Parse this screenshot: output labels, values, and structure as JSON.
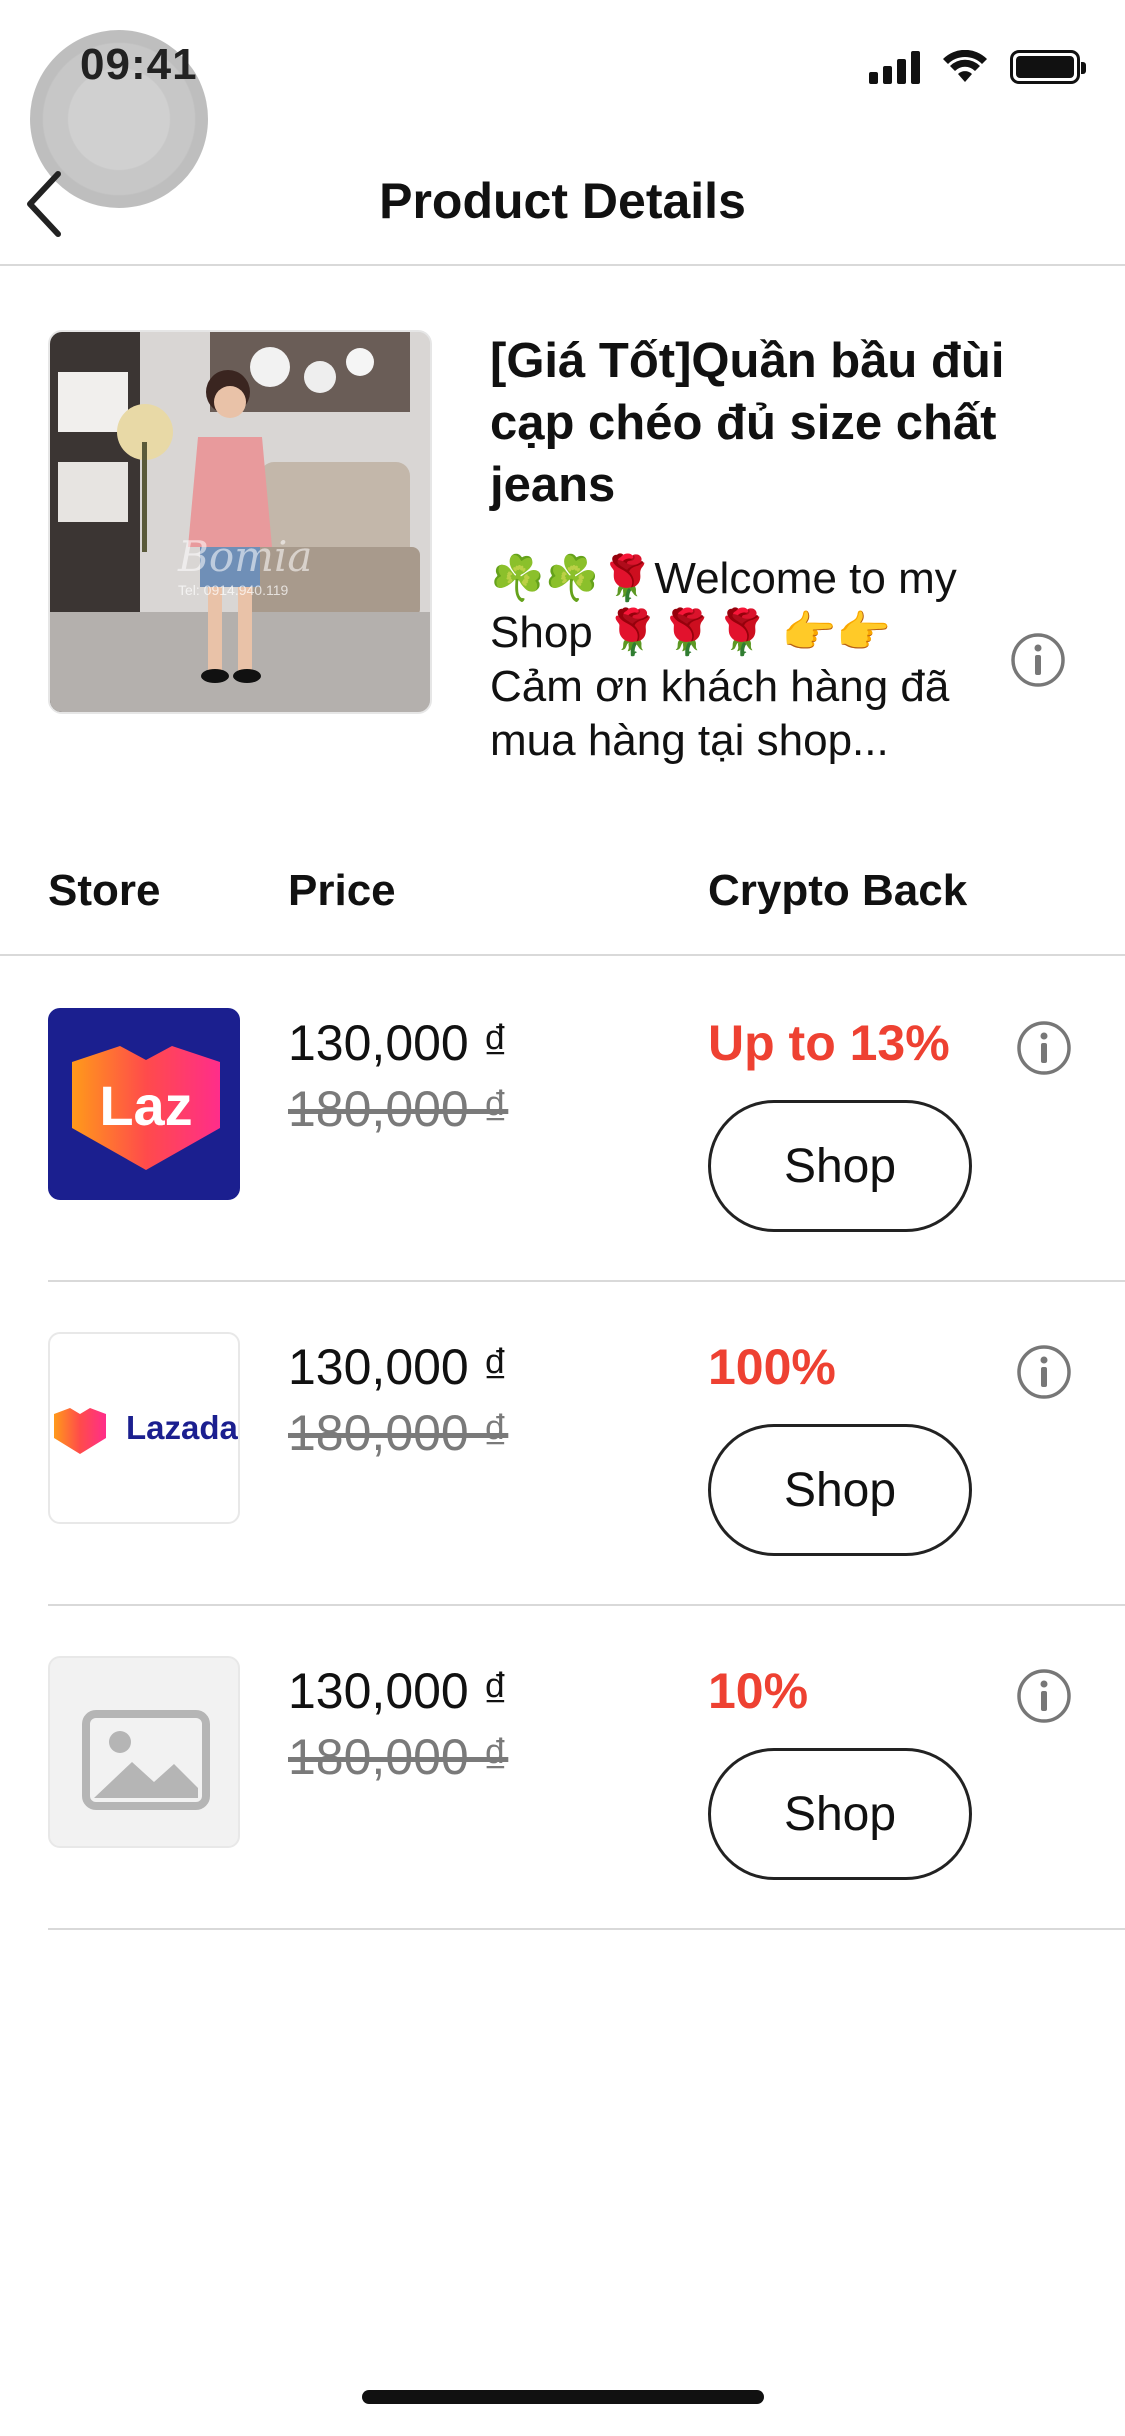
{
  "status_bar": {
    "time": "09:41"
  },
  "nav": {
    "title": "Product Details"
  },
  "product": {
    "title": "[Giá Tốt]Quần bầu đùi cạp chéo đủ size chất jeans",
    "description": "☘️☘️🌹Welcome to my Shop 🌹🌹🌹 👉👉 Cảm ơn khách hàng đã mua hàng tại shop...",
    "image_watermark": "Bomia",
    "image_phone": "Tel: 0914.940.119"
  },
  "table": {
    "headers": {
      "store": "Store",
      "price": "Price",
      "crypto_back": "Crypto Back"
    }
  },
  "offers": [
    {
      "store": "Laz",
      "logo": "laz-app-icon",
      "price": "130,000 ₫",
      "original_price": "180,000 ₫",
      "cashback": "Up to 13%",
      "button": "Shop"
    },
    {
      "store": "Lazada",
      "logo": "lazada-wordmark",
      "price": "130,000 ₫",
      "original_price": "180,000 ₫",
      "cashback": "100%",
      "button": "Shop"
    },
    {
      "store": "",
      "logo": "image-placeholder-icon",
      "price": "130,000 ₫",
      "original_price": "180,000 ₫",
      "cashback": "10%",
      "button": "Shop"
    }
  ],
  "colors": {
    "accent_red": "#ee4132",
    "laz_navy": "#1b1f8f",
    "laz_orange": "#ff6a1a",
    "laz_pink": "#ff2d8a"
  }
}
